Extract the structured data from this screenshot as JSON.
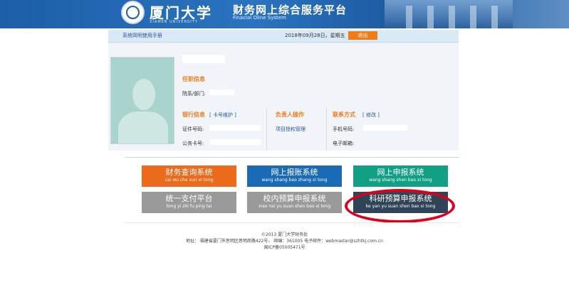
{
  "header": {
    "school_cn": "厦门大学",
    "school_en": "XIAMEN UNIVERSITY",
    "title_cn": "财务网上综合服务平台",
    "title_en": "Finacial Oline System"
  },
  "nav": {
    "manual": "系统简明使用手册",
    "date": "2018年09月28日，星期五",
    "logout": "退出"
  },
  "profile": {
    "job_info": "任职信息",
    "dept_label": "院系/部门:",
    "bank_info": "银行信息",
    "card_maintain": "[ 卡号维护 ]",
    "id_label": "证件号码:",
    "card_label": "公务卡号:",
    "principal": "负责人操作",
    "project_auth": "项目授权管理",
    "contact": "联系方式",
    "edit": "[ 修改 ]",
    "phone_label": "手机号码:",
    "email_label": "电子邮箱:"
  },
  "systems": [
    {
      "cn": "财务查询系统",
      "py": "cai wu cha xun xi tong"
    },
    {
      "cn": "网上报账系统",
      "py": "wang shang bao zhang xi tong"
    },
    {
      "cn": "网上申报系统",
      "py": "wang shang shen bao xi tong"
    },
    {
      "cn": "统一支付平台",
      "py": "tong yi zhi fu ping tai"
    },
    {
      "cn": "校内预算申报系统",
      "py": "xiao nei yu suan shen bao xi tong"
    },
    {
      "cn": "科研预算申报系统",
      "py": "ke yan yu suan shen bao xi tong"
    }
  ],
  "footer": {
    "copyright": "©2013 厦门大学财务处",
    "address": "地址：  福建省厦门市思明区思明南路422号，  邮编：361005 电子邮件：webmaster@szhtkj.com.cn",
    "icp": "闽ICP备05005471号"
  },
  "colors": {
    "orange": "#ec6a1b",
    "blue": "#1a6bb5",
    "teal": "#12a085",
    "gray": "#9a9a9a",
    "dark": "#2f4557",
    "annotation": "#e0001a"
  }
}
